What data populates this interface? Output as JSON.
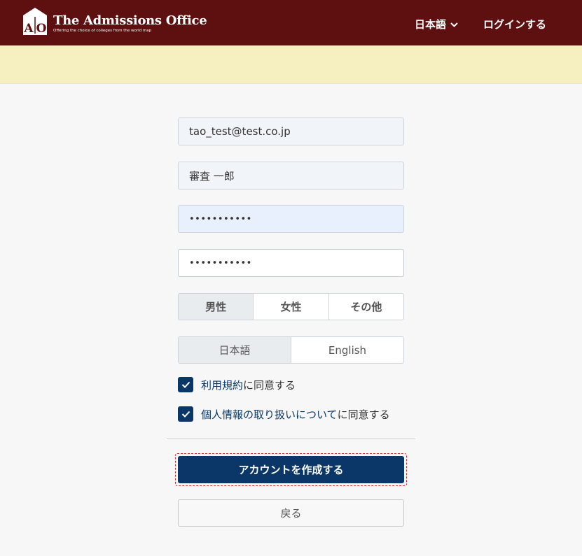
{
  "header": {
    "brand_title": "The Admissions Office",
    "brand_tagline": "Offering the choice of colleges from the world map",
    "logo_text": "AO",
    "language_menu": "日本語",
    "login_link": "ログインする"
  },
  "form": {
    "email_value": "tao_test@test.co.jp",
    "name_value": "審査 一郎",
    "password_value": "•••••••••••",
    "password_confirm_value": "•••••••••••",
    "gender_options": [
      "男性",
      "女性",
      "その他"
    ],
    "gender_selected": "男性",
    "language_options": [
      "日本語",
      "English"
    ],
    "language_selected": "日本語",
    "terms_link": "利用規約",
    "terms_suffix": "に同意する",
    "privacy_link": "個人情報の取り扱いについて",
    "privacy_suffix": "に同意する",
    "terms_checked": true,
    "privacy_checked": true,
    "submit_label": "アカウントを作成する",
    "back_label": "戻る"
  },
  "colors": {
    "header_bg": "#5e0f10",
    "banner_bg": "#f6efbf",
    "primary": "#0a3767",
    "focus_outline": "#dd3333"
  }
}
